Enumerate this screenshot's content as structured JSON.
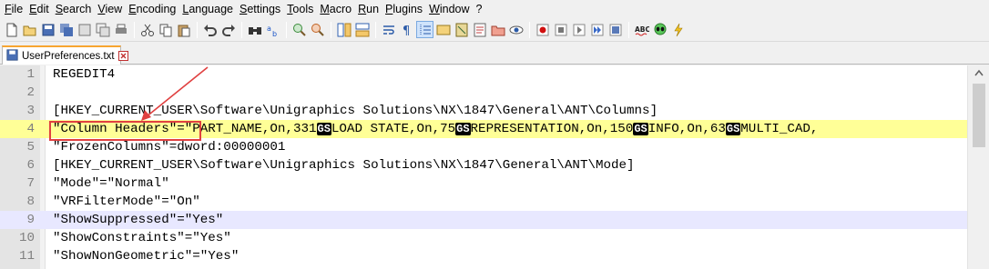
{
  "menubar": {
    "items": [
      "File",
      "Edit",
      "Search",
      "View",
      "Encoding",
      "Language",
      "Settings",
      "Tools",
      "Macro",
      "Run",
      "Plugins",
      "Window",
      "?"
    ]
  },
  "toolbar": {
    "buttons": [
      "new-file-icon",
      "open-file-icon",
      "save-icon",
      "save-all-icon",
      "close-icon",
      "close-all-icon",
      "print-icon",
      "cut-icon",
      "copy-icon",
      "paste-icon",
      "undo-icon",
      "redo-icon",
      "find-icon",
      "replace-icon",
      "zoom-in-icon",
      "zoom-out-icon",
      "sync-vertical-icon",
      "sync-horizontal-icon",
      "word-wrap-icon",
      "show-all-chars-icon",
      "indent-guide-icon",
      "udl-icon",
      "doc-map-icon",
      "function-list-icon",
      "folder-workspace-icon",
      "monitoring-icon",
      "record-macro-icon",
      "stop-macro-icon",
      "play-macro-icon",
      "run-macro-multiple-icon",
      "save-macro-icon",
      "spell-check-icon",
      "alien-icon",
      "lightning-icon"
    ]
  },
  "tab": {
    "label": "UserPreferences.txt"
  },
  "editor": {
    "lines": [
      {
        "num": "1",
        "text": "REGEDIT4"
      },
      {
        "num": "2",
        "text": ""
      },
      {
        "num": "3",
        "text": "[HKEY_CURRENT_USER\\Software\\Unigraphics Solutions\\NX\\1847\\General\\ANT\\Columns]"
      },
      {
        "num": "4",
        "key": "\"Column Headers\"",
        "eq": "=",
        "segments": [
          "\"PART_NAME,On,331",
          "LOAD STATE,On,75",
          "REPRESENTATION,On,150",
          "INFO,On,63",
          "MULTI_CAD,"
        ],
        "sep": "GS"
      },
      {
        "num": "5",
        "text": "\"FrozenColumns\"=dword:00000001"
      },
      {
        "num": "6",
        "text": "[HKEY_CURRENT_USER\\Software\\Unigraphics Solutions\\NX\\1847\\General\\ANT\\Mode]"
      },
      {
        "num": "7",
        "text": "\"Mode\"=\"Normal\""
      },
      {
        "num": "8",
        "text": "\"VRFilterMode\"=\"On\""
      },
      {
        "num": "9",
        "text": "\"ShowSuppressed\"=\"Yes\""
      },
      {
        "num": "10",
        "text": "\"ShowConstraints\"=\"Yes\""
      },
      {
        "num": "11",
        "text": "\"ShowNonGeometric\"=\"Yes\""
      }
    ]
  },
  "colors": {
    "current_line": "#ffff97",
    "marked_line": "#e8e8ff",
    "annotation": "#e04040",
    "tab_accent": "#f7a531"
  }
}
